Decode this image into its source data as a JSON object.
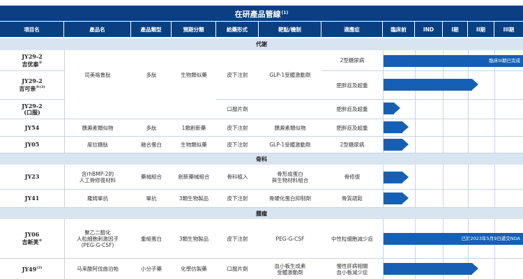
{
  "title": "在研產品管線",
  "title_note": "(1)",
  "headers": [
    "項目名",
    "產品名",
    "產品類型",
    "預期分類",
    "給藥形式",
    "靶點/機制",
    "適應症",
    "臨床前",
    "IND",
    "I期",
    "II期",
    "III期"
  ],
  "sections": {
    "metabolic": "代謝",
    "orthopedics": "骨科",
    "oncology": "腫瘤"
  },
  "rows": {
    "r1": {
      "project": "JY29-2",
      "project2": "吉优泰",
      "mark": "®",
      "indication": "2型糖尿病",
      "bar_label": "臨床III期已完成"
    },
    "r2": {
      "project": "JY29-2",
      "project2": "吉可亲",
      "mark": "®(3)",
      "indication": "肥胖症及超重"
    },
    "r3": {
      "project": "JY29-2",
      "project2": "(口服)",
      "route": "口服片劑",
      "indication": "肥胖症及超重"
    },
    "r4": {
      "project": "JY54",
      "product": "胰澱素類似物",
      "type": "多肽",
      "category": "1類創新藥",
      "route": "皮下注射",
      "target": "胰澱素類似物",
      "indication": "肥胖症及超重"
    },
    "r5": {
      "project": "JY05",
      "product": "度拉糖肽",
      "type": "融合蛋白",
      "category": "生物類似藥",
      "route": "皮下注射",
      "target": "GLP-1受體激動劑",
      "indication": "2型糖尿病"
    },
    "r6": {
      "project": "JY23",
      "product": "含rhBMP-2的\n人工骨修復材料",
      "type": "藥械組合",
      "category": "創新藥械組合",
      "route": "骨科植入",
      "target": "骨形成蛋白\n與生物材料組合",
      "indication": "骨修復"
    },
    "r7": {
      "project": "JY41",
      "product": "羅姆單抗",
      "type": "單抗",
      "category": "3類生物製品",
      "route": "皮下注射",
      "target": "骨硬化蛋白抑制劑",
      "indication": "骨質疏鬆"
    },
    "r8": {
      "project": "JY06",
      "project2": "吉新芙",
      "mark": "®",
      "product": "聚乙二醇化\n人粒細胞刺激因子\n(PEG-G-CSF)",
      "type": "重組蛋白",
      "category": "3類生物製品",
      "route": "皮下注射",
      "target": "PEG-G-CSF",
      "indication": "中性粒細胞減少症",
      "bar_label": "已於2023年5月9日遞交NDA"
    },
    "r9": {
      "project": "JY49",
      "mark": "(2)",
      "product": "马来酸阿伐曲泊帕",
      "type": "小分子藥",
      "category": "化學仿製藥",
      "route": "口服片劑",
      "target": "血小板生成素\n受體激動劑",
      "indication": "慢性肝病相關\n血小板減少症"
    }
  },
  "merged_r1_r3": {
    "product": "司美格鲁肽",
    "type": "多肽",
    "category": "生物類似藥",
    "route": "皮下注射",
    "target": "GLP-1受體激動劑"
  },
  "progress_stage_fractions": {
    "r1": 1.0,
    "r2": 0.68,
    "r3": 0.12,
    "r4": 0.18,
    "r5": 0.18,
    "r6": 0.18,
    "r7": 0.18,
    "r8": 1.0,
    "r9": 0.68
  }
}
